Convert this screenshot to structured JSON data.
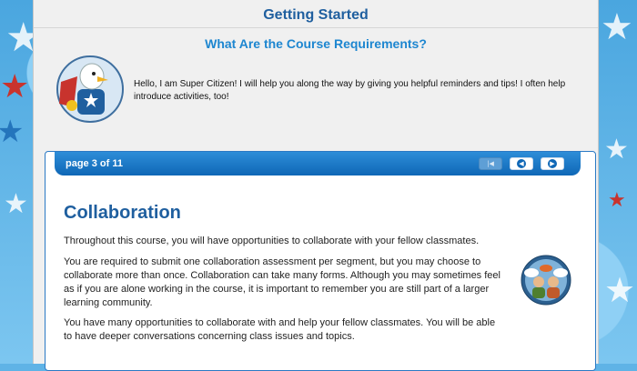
{
  "header": {
    "title": "Getting Started",
    "subtitle": "What Are the Course Requirements?"
  },
  "mascot": {
    "intro_text": "Hello, I am Super Citizen! I will help you along the way by giving you helpful reminders and tips! I often help introduce activities, too!"
  },
  "pager": {
    "label": "page 3 of 11",
    "buttons": [
      {
        "icon": "first-page-icon",
        "state": "disabled"
      },
      {
        "icon": "previous-page-icon",
        "state": "enabled"
      },
      {
        "icon": "next-page-icon",
        "state": "enabled"
      }
    ]
  },
  "content": {
    "heading": "Collaboration",
    "paragraphs": [
      "Throughout this course, you will have opportunities to collaborate with your fellow classmates.",
      "You are required to submit one collaboration assessment per segment, but you may choose to collaborate more than once. Collaboration can take many forms. Although you may sometimes feel as if you are alone working in the course, it is important to remember you are still part of a larger learning community.",
      "You have many opportunities to collaborate with and help your fellow classmates. You will be able to have deeper conversations concerning class issues and topics."
    ]
  },
  "colors": {
    "title": "#1f5f9f",
    "subtitle": "#1d86d0",
    "nav_bar": "#0f67b6"
  }
}
